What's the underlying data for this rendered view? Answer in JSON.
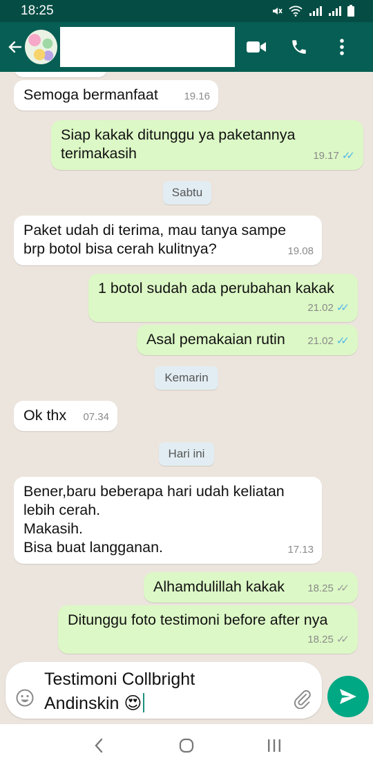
{
  "status": {
    "time": "18:25",
    "icons": [
      "mute-icon",
      "wifi-icon",
      "signal-icon",
      "signal-icon",
      "battery-icon"
    ]
  },
  "header": {
    "back_icon": "arrow-left-icon",
    "video_icon": "video-call-icon",
    "call_icon": "phone-icon",
    "menu_icon": "more-vert-icon"
  },
  "messages": [
    {
      "dir": "in",
      "text": "Semoga bermanfaat",
      "time": "19.16"
    },
    {
      "dir": "out",
      "text": "Siap kakak ditunggu ya paketannya\nterimakasih",
      "time": "19.17",
      "ticks": "read"
    },
    {
      "dir": "chip",
      "text": "Sabtu"
    },
    {
      "dir": "in",
      "text": "Paket udah di terima, mau tanya sampe\nbrp botol bisa cerah kulitnya?",
      "time": "19.08"
    },
    {
      "dir": "out",
      "text": "1 botol sudah ada perubahan kakak",
      "time": "21.02",
      "ticks": "read"
    },
    {
      "dir": "out",
      "text": "Asal pemakaian rutin",
      "time": "21.02",
      "ticks": "read"
    },
    {
      "dir": "chip",
      "text": "Kemarin"
    },
    {
      "dir": "in",
      "text": "Ok thx",
      "time": "07.34"
    },
    {
      "dir": "chip",
      "text": "Hari ini"
    },
    {
      "dir": "in",
      "text": "Bener,baru beberapa hari udah keliatan\nlebih cerah.\nMakasih.\nBisa buat langganan.",
      "time": "17.13"
    },
    {
      "dir": "out",
      "text": "Alhamdulillah kakak",
      "time": "18.25",
      "ticks": "delivered"
    },
    {
      "dir": "out",
      "text": "Ditunggu foto testimoni before after nya",
      "time": "18.25",
      "ticks": "delivered"
    }
  ],
  "composer": {
    "text": "Testimoni Collbright\nAndinskin 😍",
    "emoji_icon": "emoji-icon",
    "attach_icon": "paperclip-icon",
    "send_icon": "send-icon"
  },
  "colors": {
    "header": "#075e54",
    "status": "#054d44",
    "outgoing": "#dcf8c6",
    "incoming": "#ffffff",
    "background": "#ece5dd",
    "read_ticks": "#4fb5ec",
    "send": "#00a884"
  }
}
